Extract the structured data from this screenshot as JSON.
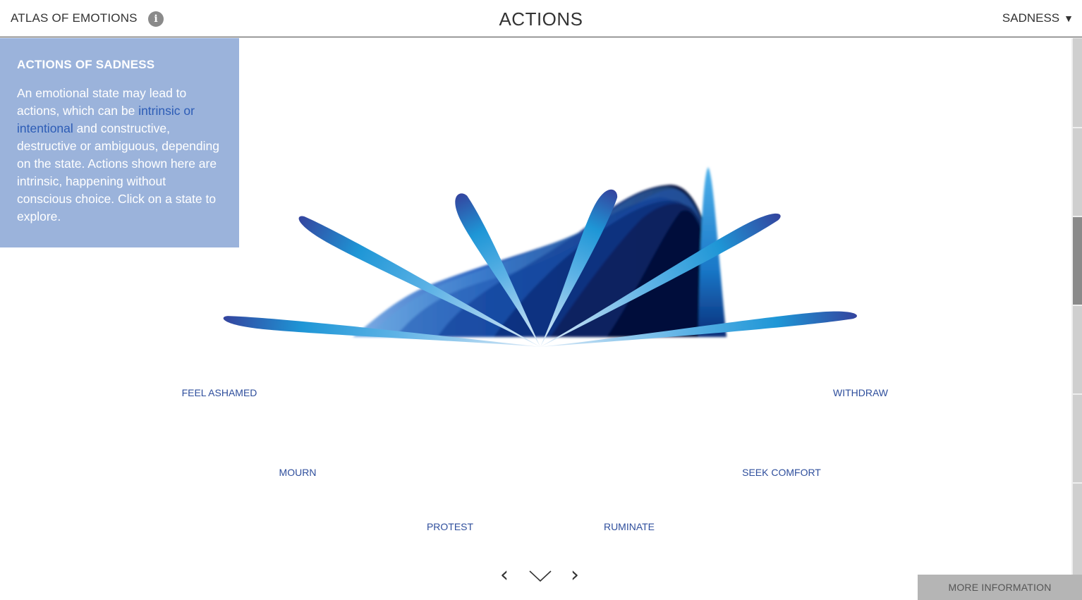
{
  "header": {
    "brand": "ATLAS OF EMOTIONS",
    "info_icon": "i",
    "title": "ACTIONS",
    "emotion": "SADNESS",
    "caret": "▼"
  },
  "infobox": {
    "heading": "ACTIONS OF SADNESS",
    "text_before": "An emotional state may lead to actions, which can be ",
    "link": "intrinsic or intentional",
    "text_after": " and constructive, destructive or ambiguous, depending on the state. Actions shown here are intrinsic, happening without conscious choice. Click on a state to explore."
  },
  "actions": [
    {
      "label": "FEEL ASHAMED"
    },
    {
      "label": "MOURN"
    },
    {
      "label": "PROTEST"
    },
    {
      "label": "RUMINATE"
    },
    {
      "label": "SEEK COMFORT"
    },
    {
      "label": "WITHDRAW"
    }
  ],
  "nav": {
    "prev": "‹",
    "down": "﹀",
    "next": "›"
  },
  "more_info": "MORE INFORMATION",
  "icons": {
    "info": "info-icon",
    "caret": "caret-down-icon",
    "prev": "chevron-left-icon",
    "next": "chevron-right-icon",
    "down": "chevron-down-icon"
  },
  "colors": {
    "infobox_bg": "#9bb3db",
    "link": "#2c5cb6",
    "label": "#2e4e9c",
    "petal_light": "#cfe3f5",
    "petal_mid": "#1e96d6",
    "petal_dark": "#34449e",
    "mound_dark": "#050a22",
    "more_info_bg": "#b5b5b5"
  }
}
